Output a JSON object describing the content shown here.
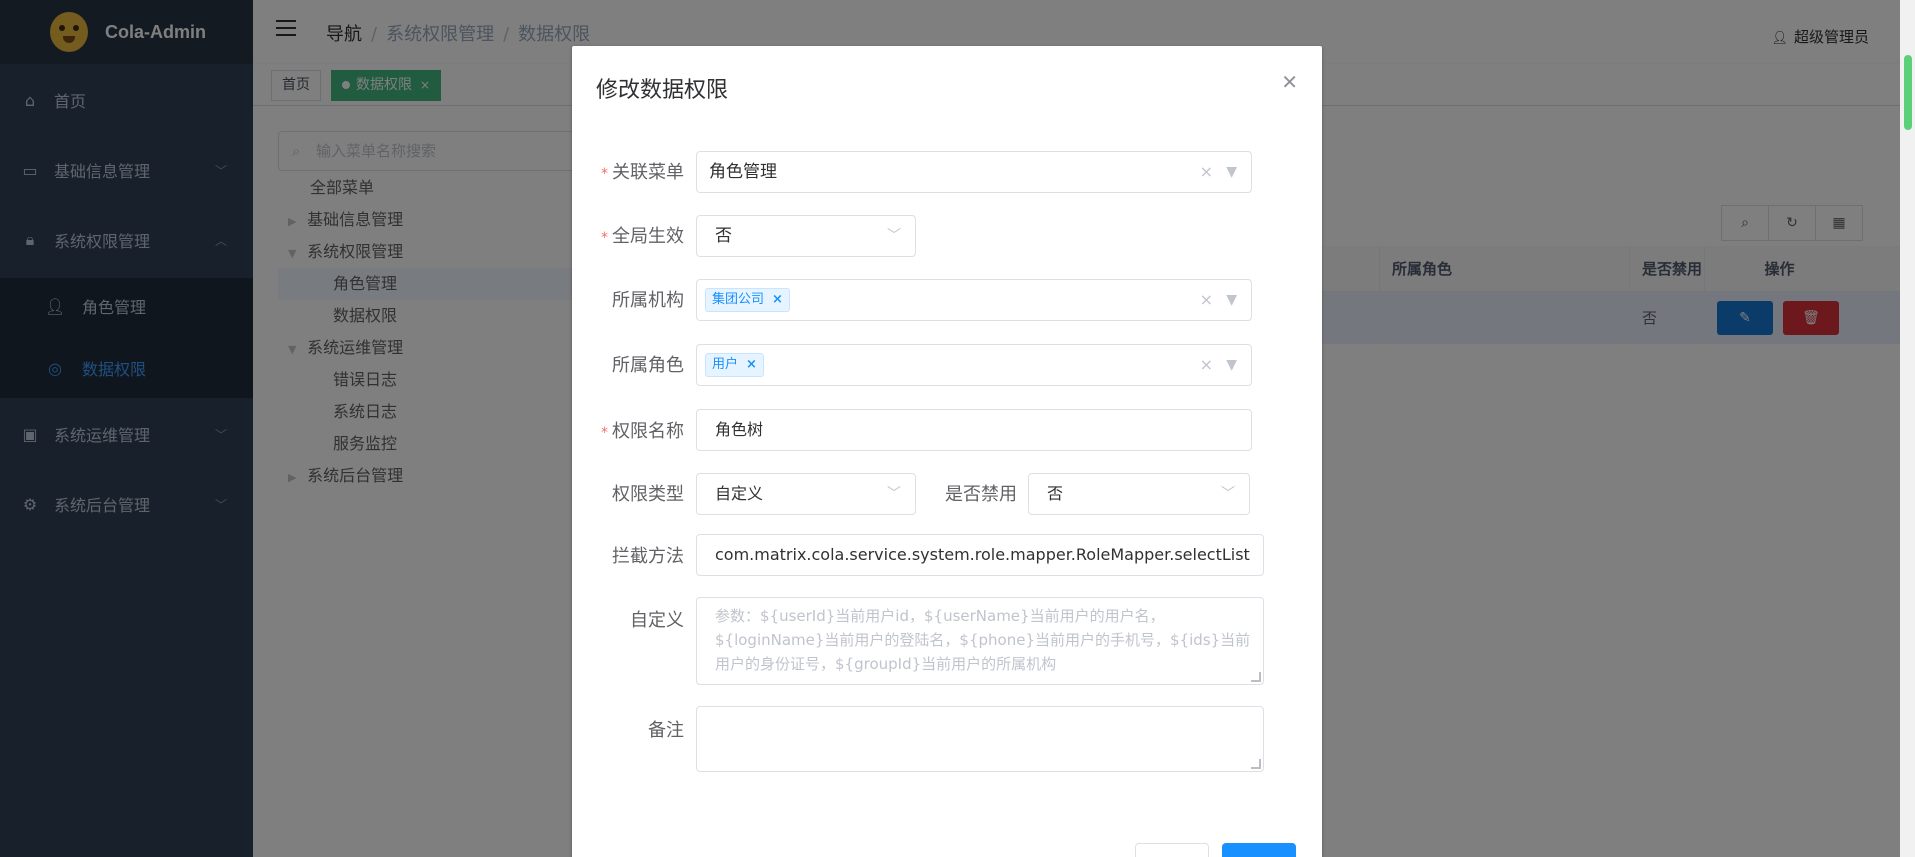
{
  "app": {
    "title": "Cola-Admin"
  },
  "sidebar": {
    "items": [
      {
        "label": "首页",
        "icon": "home-icon"
      },
      {
        "label": "基础信息管理",
        "icon": "document-icon"
      },
      {
        "label": "系统权限管理",
        "icon": "lock-icon"
      },
      {
        "label": "系统运维管理",
        "icon": "briefcase-icon"
      },
      {
        "label": "系统后台管理",
        "icon": "gear-icon"
      }
    ],
    "sub_items": [
      {
        "label": "角色管理",
        "icon": "user-icon"
      },
      {
        "label": "数据权限",
        "icon": "compass-icon"
      }
    ]
  },
  "header": {
    "breadcrumb": [
      "导航",
      "系统权限管理",
      "数据权限"
    ],
    "user": "超级管理员"
  },
  "tags": {
    "home": "首页",
    "active": "数据权限"
  },
  "tree": {
    "search_placeholder": "输入菜单名称搜索",
    "nodes": [
      "全部菜单",
      "基础信息管理",
      "系统权限管理",
      "角色管理",
      "数据权限",
      "系统运维管理",
      "错误日志",
      "系统日志",
      "服务监控",
      "系统后台管理"
    ]
  },
  "table": {
    "headers": {
      "role": "所属角色",
      "disabled": "是否禁用",
      "actions": "操作"
    },
    "row": {
      "disabled": "否"
    }
  },
  "dialog": {
    "title": "修改数据权限",
    "fields": {
      "menu_label": "关联菜单",
      "menu_value": "角色管理",
      "global_label": "全局生效",
      "global_value": "否",
      "org_label": "所属机构",
      "org_tag": "集团公司",
      "role_label": "所属角色",
      "role_tag": "用户",
      "name_label": "权限名称",
      "name_value": "角色树",
      "type_label": "权限类型",
      "type_value": "自定义",
      "disable_label": "是否禁用",
      "disable_value": "否",
      "method_label": "拦截方法",
      "method_value": "com.matrix.cola.service.system.role.mapper.RoleMapper.selectList",
      "custom_label": "自定义",
      "custom_placeholder": "参数：${userId}当前用户id，${userName}当前用户的用户名，${loginName}当前用户的登陆名，${phone}当前用户的手机号，${ids}当前用户的身份证号，${groupId}当前用户的所属机构",
      "remark_label": "备注"
    }
  },
  "colors": {
    "sidebar": "#304156",
    "accent": "#409eff",
    "tag_active": "#42b983",
    "edit": "#1677d2",
    "delete": "#d8303a"
  }
}
